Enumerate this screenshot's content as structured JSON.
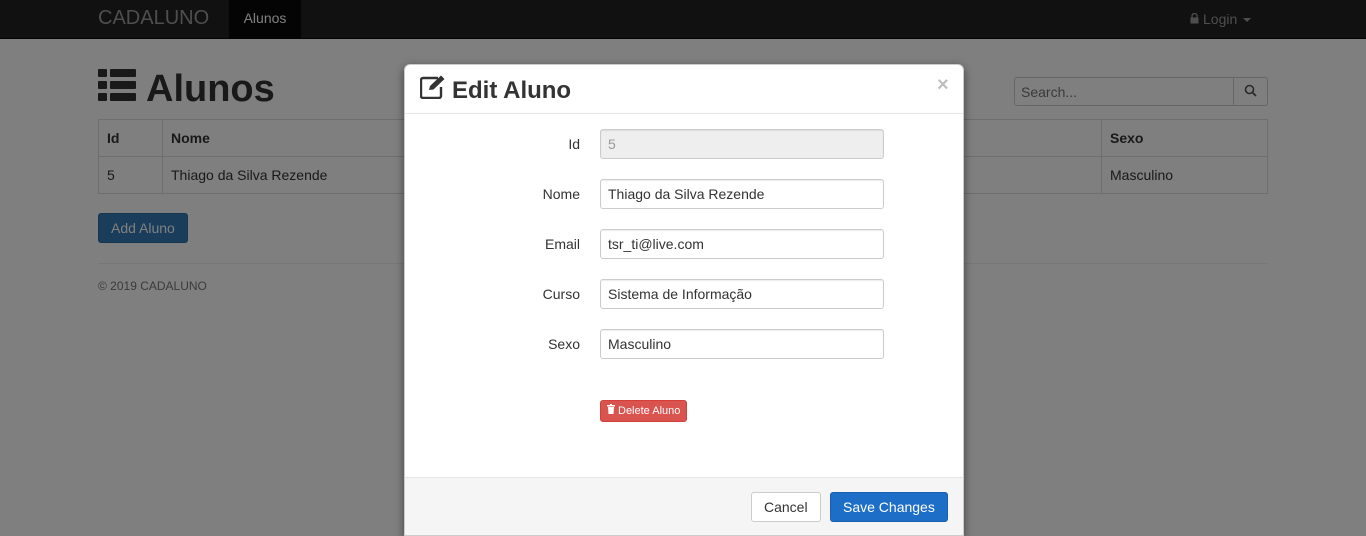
{
  "navbar": {
    "brand": "CADALUNO",
    "active_tab": "Alunos",
    "login_label": "Login"
  },
  "page": {
    "title": "Alunos",
    "search_placeholder": "Search..."
  },
  "table": {
    "headers": [
      "Id",
      "Nome",
      "Sexo"
    ],
    "rows": [
      {
        "id": "5",
        "nome": "Thiago da Silva Rezende",
        "sexo": "Masculino"
      }
    ]
  },
  "add_button": "Add Aluno",
  "footer": "© 2019 CADALUNO",
  "modal": {
    "title": "Edit Aluno",
    "close": "×",
    "fields": [
      {
        "label": "Id",
        "value": "5"
      },
      {
        "label": "Nome",
        "value": "Thiago da Silva Rezende"
      },
      {
        "label": "Email",
        "value": "tsr_ti@live.com"
      },
      {
        "label": "Curso",
        "value": "Sistema de Informação"
      },
      {
        "label": "Sexo",
        "value": "Masculino"
      }
    ],
    "delete_label": "Delete Aluno",
    "cancel_label": "Cancel",
    "save_label": "Save Changes"
  },
  "colors": {
    "primary": "#337ab7",
    "danger": "#d9534f",
    "navbar": "#222222"
  },
  "icons": {
    "title_icon": "list-icon",
    "modal_icon": "edit-icon",
    "login_icon": "lock-icon",
    "search_icon": "search-icon",
    "delete_icon": "trash-icon"
  }
}
